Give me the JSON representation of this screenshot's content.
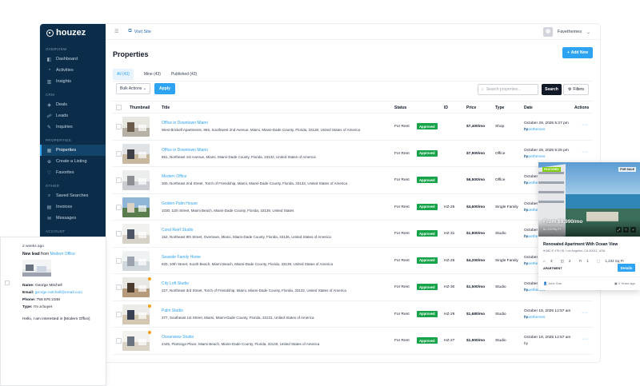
{
  "brand": {
    "name": "houzez",
    "accent": "#2ea3f2",
    "sidebar_bg": "#0b2d4a",
    "success": "#16a34a"
  },
  "sidebar": {
    "sections": [
      {
        "title": "OVERVIEW",
        "items": [
          {
            "label": "Dashboard",
            "icon": "dashboard-icon"
          },
          {
            "label": "Activities",
            "icon": "activities-icon"
          },
          {
            "label": "Insights",
            "icon": "insights-icon"
          }
        ]
      },
      {
        "title": "CRM",
        "items": [
          {
            "label": "Deals",
            "icon": "deals-icon"
          },
          {
            "label": "Leads",
            "icon": "leads-icon"
          },
          {
            "label": "Inquiries",
            "icon": "inquiries-icon"
          }
        ]
      },
      {
        "title": "PROPERTIES",
        "items": [
          {
            "label": "Properties",
            "icon": "properties-icon",
            "active": true
          },
          {
            "label": "Create a Listing",
            "icon": "create-listing-icon"
          },
          {
            "label": "Favorites",
            "icon": "heart-icon"
          }
        ]
      },
      {
        "title": "OTHER",
        "items": [
          {
            "label": "Saved Searches",
            "icon": "saved-search-icon"
          },
          {
            "label": "Invoices",
            "icon": "invoices-icon"
          },
          {
            "label": "Messages",
            "icon": "messages-icon"
          }
        ]
      },
      {
        "title": "ACCOUNT",
        "items": []
      }
    ]
  },
  "topbar": {
    "visit_site": "Visit Site",
    "user_name": "Favethemes"
  },
  "page": {
    "title": "Properties",
    "add_new": "Add New"
  },
  "tabs": [
    {
      "label": "All (43)",
      "active": true
    },
    {
      "label": "Mine (43)"
    },
    {
      "label": "Published (43)"
    }
  ],
  "toolbar": {
    "bulk_actions": "Bulk Actions",
    "apply": "Apply",
    "search_placeholder": "Search properties...",
    "search": "Search",
    "filters": "Filters"
  },
  "table": {
    "columns": [
      "Thumbnail",
      "Title",
      "Status",
      "ID",
      "Price",
      "Type",
      "Date",
      "Actions"
    ],
    "rows": [
      {
        "title": "Office in Downtown Miami",
        "address": "West Brickell Apartments, 955, Southwest 2nd Avenue, Miami, Miami-Dade County, Florida, 33130, United States of America",
        "status": "For Rent",
        "badge": "Approved",
        "id": "",
        "price": "$7,400/mo",
        "type": "Shop",
        "date": "October 29, 2025 5:27 pm",
        "by": "by",
        "author": "Favethemes",
        "featured": false
      },
      {
        "title": "Office in Downtown Miami",
        "address": "851, Northeast 1st Avenue, Miami, Miami-Dade County, Florida, 33132, United States of America",
        "status": "For Rent",
        "badge": "Approved",
        "id": "",
        "price": "$7,900/mo",
        "type": "Office",
        "date": "October 29, 2025 5:25 pm",
        "by": "by",
        "author": "Favethemes",
        "featured": false
      },
      {
        "title": "Modern Office",
        "address": "300, Northeast 2nd Street, Torch of Friendship, Miami, Miami-Dade County, Florida, 33132, United States of America",
        "status": "For Rent",
        "badge": "Approved",
        "id": "",
        "price": "$6,500/mo",
        "type": "Office",
        "date": "October 2",
        "by": "by",
        "author": "Favethe",
        "featured": false
      },
      {
        "title": "Golden Palm House",
        "address": "1030, 11th Street, Miami Beach, Miami-Dade County, Florida, 33139, United States",
        "status": "For Rent",
        "badge": "Approved",
        "id": "HZ-25",
        "price": "$4,600/mo",
        "type": "Single Family",
        "date": "October 2",
        "by": "by",
        "author": "Favethe",
        "featured": false
      },
      {
        "title": "Coral Reef Studio",
        "address": "152, Northeast 8th Street, Overtown, Miami, Miami-Dade County, Florida, 33136, United States of America",
        "status": "For Rent",
        "badge": "Approved",
        "id": "HZ-31",
        "price": "$1,800/mo",
        "type": "Studio",
        "date": "October 2",
        "by": "by",
        "author": "Favethe",
        "featured": false
      },
      {
        "title": "Seaside Family Home",
        "address": "820, 10th Street, South Beach, Miami Beach, Miami-Dade County, Florida, 33139, United States of America",
        "status": "For Rent",
        "badge": "Approved",
        "id": "HZ-26",
        "price": "$4,200/mo",
        "type": "Single Family",
        "date": "October 2",
        "by": "by",
        "author": "Favethe",
        "featured": false
      },
      {
        "title": "City Loft Studio",
        "address": "227, Northeast 3rd Street, Torch of Friendship, Miami, Miami-Dade County, Florida, 33132, United States of America",
        "status": "For Rent",
        "badge": "Approved",
        "id": "HZ-30",
        "price": "$1,500/mo",
        "type": "Studio",
        "date": "October 19, 2025 12:57 am",
        "by": "by",
        "author": "Favethemes",
        "featured": true
      },
      {
        "title": "Palm Studio",
        "address": "377, Southeast 1st Street, Miami, Miami-Dade County, Florida, 33131, United States of America",
        "status": "For Rent",
        "badge": "Approved",
        "id": "HZ-29",
        "price": "$1,680/mo",
        "type": "Studio",
        "date": "October 19, 2025 12:57 am",
        "by": "by",
        "author": "Favethemes",
        "featured": true
      },
      {
        "title": "Oceanview Studio",
        "address": "2445, Flamingo Place, Miami Beach, Miami-Dade County, Florida, 33140, United States of America",
        "status": "For Rent",
        "badge": "Approved",
        "id": "HZ-27",
        "price": "$1,900/mo",
        "type": "Studio",
        "date": "October 19, 2025 12:57 am",
        "by": "by",
        "author": "",
        "featured": true
      }
    ]
  },
  "notification": {
    "time": "2 weeks ago",
    "lead_prefix": "New lead",
    "lead_from": "from",
    "lead_link": "Modern Office",
    "name_label": "Name:",
    "name": "George Mitchell",
    "email_label": "Email:",
    "email": "george.mitchell@email.com",
    "phone_label": "Phone:",
    "phone": "756 876 2348",
    "type_label": "Type:",
    "type": "I'm a buyer",
    "message": "Hello, I am interested in [Modern Office]"
  },
  "property_card": {
    "featured": "FEATURED",
    "for_sale": "FOR SALE",
    "price": "From $9,990/mo",
    "sqft": "$1,250/Sq Ft",
    "title": "Renovated Apartment With Ocean View",
    "address": "680 E 47th St, Los Angeles, CA 90011, USA",
    "beds": "3",
    "baths": "2",
    "garage": "1",
    "area": "1,234 Sq Ft",
    "type": "APARTMENT",
    "details": "Details",
    "agent": "John Sue",
    "ago": "3 Years ago"
  }
}
